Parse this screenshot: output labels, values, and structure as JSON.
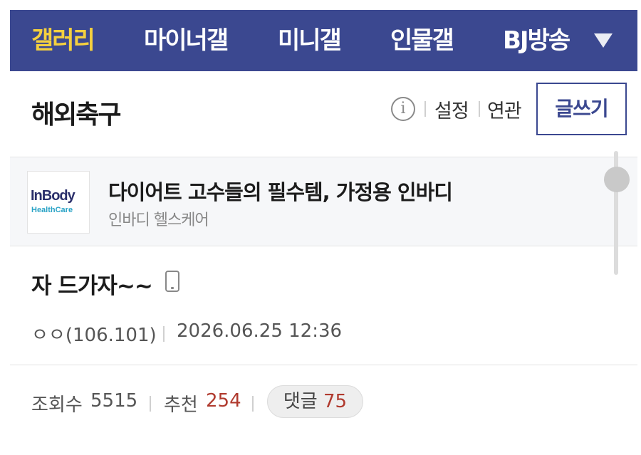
{
  "nav": {
    "items": [
      {
        "label": "갤러리",
        "active": true
      },
      {
        "label": "마이너갤",
        "active": false
      },
      {
        "label": "미니갤",
        "active": false
      },
      {
        "label": "인물갤",
        "active": false
      },
      {
        "label": "BJ방송",
        "active": false
      }
    ],
    "dropdown_icon": "triangle-down-icon",
    "background_color": "#3b4890",
    "active_color": "#f4d03f"
  },
  "header": {
    "gallery_name": "해외축구",
    "info_icon": "i",
    "settings_label": "설정",
    "related_label": "연관",
    "write_button_label": "글쓰기"
  },
  "ad": {
    "logo_line1": "InBody",
    "logo_line2": "HealthCare",
    "title": "다이어트 고수들의 필수템, 가정용 인바디",
    "advertiser": "인바디 헬스케어"
  },
  "post": {
    "title": "자 드가자~~",
    "device_icon": "mobile-phone-icon",
    "author": "ㅇㅇ(106.101)",
    "datetime": "2026.06.25 12:36",
    "views_label": "조회수",
    "views": "5515",
    "recommend_label": "추천",
    "recommend": "254",
    "comments_label": "댓글",
    "comments": "75"
  }
}
